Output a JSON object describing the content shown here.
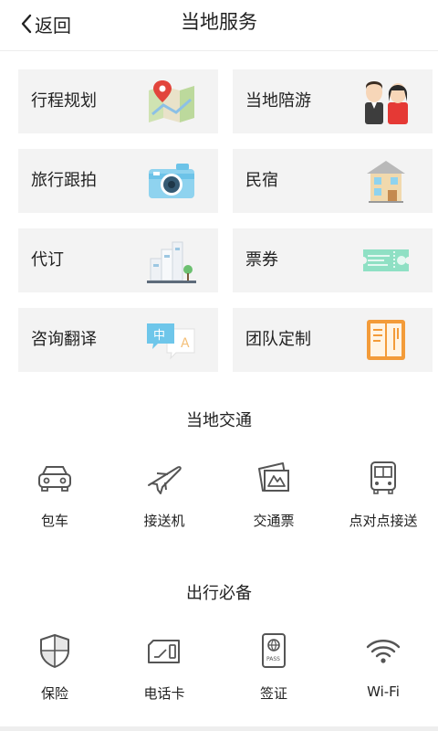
{
  "header": {
    "back_label": "返回",
    "title": "当地服务"
  },
  "services": [
    {
      "label": "行程规划",
      "icon": "map-pin-illustration"
    },
    {
      "label": "当地陪游",
      "icon": "tour-guide-people-illustration"
    },
    {
      "label": "旅行跟拍",
      "icon": "camera-illustration"
    },
    {
      "label": "民宿",
      "icon": "house-illustration"
    },
    {
      "label": "代订",
      "icon": "buildings-illustration"
    },
    {
      "label": "票券",
      "icon": "ticket-illustration"
    },
    {
      "label": "咨询翻译",
      "icon": "translation-bubbles-illustration"
    },
    {
      "label": "团队定制",
      "icon": "menu-book-illustration"
    }
  ],
  "transport": {
    "title": "当地交通",
    "items": [
      {
        "label": "包车",
        "icon": "car-icon"
      },
      {
        "label": "接送机",
        "icon": "airplane-icon"
      },
      {
        "label": "交通票",
        "icon": "transport-ticket-icon"
      },
      {
        "label": "点对点接送",
        "icon": "bus-icon"
      }
    ]
  },
  "essentials": {
    "title": "出行必备",
    "items": [
      {
        "label": "保险",
        "icon": "shield-icon"
      },
      {
        "label": "电话卡",
        "icon": "sim-card-icon"
      },
      {
        "label": "签证",
        "icon": "passport-icon"
      },
      {
        "label": "Wi-Fi",
        "icon": "wifi-icon"
      }
    ]
  }
}
